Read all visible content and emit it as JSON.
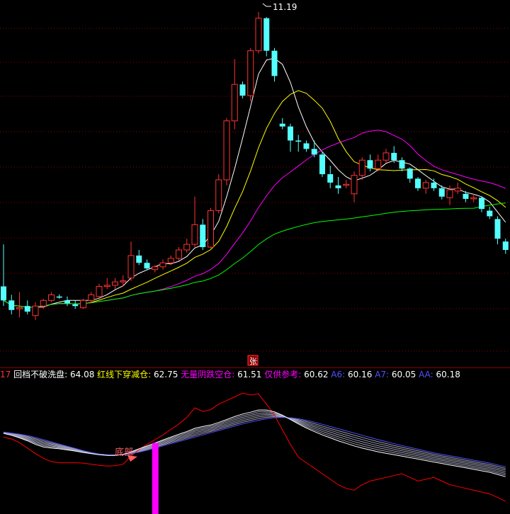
{
  "colors": {
    "background": "#000000",
    "grid": "#8b0000",
    "up": "#ff3232",
    "down": "#54ffff",
    "ma5": "#ffffff",
    "ma10": "#ffff00",
    "ma20": "#ff00ff",
    "ma60": "#00ff00",
    "red_line": "#ff0000",
    "blue_line": "#5050ff",
    "bar_magenta": "#ff00ff"
  },
  "top_chart": {
    "high_label": "11.19",
    "marker_label": "张"
  },
  "legend": {
    "left_num": "17",
    "items": [
      {
        "label": "回档不破洗盘:",
        "value": "64.08",
        "color": "#ffffff"
      },
      {
        "label": "红线下穿减仓:",
        "value": "62.75",
        "color": "#ffff00"
      },
      {
        "label": "无量阴跌空仓:",
        "value": "61.51",
        "color": "#ff00ff"
      },
      {
        "label": "仅供参考:",
        "value": "60.62",
        "color": "#ff00ff"
      },
      {
        "label": "A6:",
        "value": "60.16",
        "color": "#5050ff"
      },
      {
        "label": "A7:",
        "value": "60.05",
        "color": "#5050ff"
      },
      {
        "label": "AA:",
        "value": "60.18",
        "color": "#5050ff"
      }
    ]
  },
  "bottom_chart": {
    "annotation": "底部"
  },
  "chart_data": [
    {
      "type": "candlestick",
      "high_marker": "11.19",
      "ohlc": [
        [
          6.3,
          7.05,
          5.95,
          6.05
        ],
        [
          6.05,
          6.15,
          5.8,
          5.88
        ],
        [
          5.9,
          6.2,
          5.75,
          5.92
        ],
        [
          5.95,
          6.05,
          5.8,
          5.85
        ],
        [
          5.78,
          6.02,
          5.7,
          5.95
        ],
        [
          5.95,
          6.08,
          5.9,
          6.05
        ],
        [
          6.05,
          6.2,
          6.02,
          6.15
        ],
        [
          6.12,
          6.16,
          6.08,
          6.1
        ],
        [
          6.05,
          6.12,
          5.95,
          6.0
        ],
        [
          5.98,
          6.05,
          5.9,
          5.95
        ],
        [
          5.92,
          6.08,
          5.9,
          6.05
        ],
        [
          6.05,
          6.2,
          6.0,
          6.15
        ],
        [
          6.12,
          6.35,
          6.1,
          6.3
        ],
        [
          6.3,
          6.45,
          6.25,
          6.32
        ],
        [
          6.32,
          6.45,
          6.25,
          6.38
        ],
        [
          6.38,
          6.5,
          6.3,
          6.4
        ],
        [
          6.45,
          7.1,
          6.4,
          6.85
        ],
        [
          6.85,
          6.95,
          6.68,
          6.72
        ],
        [
          6.72,
          6.78,
          6.6,
          6.62
        ],
        [
          6.6,
          6.68,
          6.55,
          6.65
        ],
        [
          6.65,
          6.78,
          6.6,
          6.72
        ],
        [
          6.72,
          6.85,
          6.68,
          6.8
        ],
        [
          6.8,
          7.0,
          6.75,
          6.95
        ],
        [
          6.95,
          7.15,
          6.9,
          7.05
        ],
        [
          7.05,
          7.9,
          7.0,
          7.4
        ],
        [
          7.4,
          7.5,
          6.95,
          7.0
        ],
        [
          7.0,
          7.7,
          6.98,
          7.65
        ],
        [
          7.65,
          8.3,
          7.6,
          8.2
        ],
        [
          8.2,
          9.3,
          8.1,
          9.25
        ],
        [
          9.25,
          10.35,
          9.1,
          9.9
        ],
        [
          9.9,
          9.95,
          9.65,
          9.7
        ],
        [
          9.7,
          10.55,
          9.6,
          10.5
        ],
        [
          10.5,
          11.19,
          10.45,
          11.08
        ],
        [
          11.08,
          11.1,
          10.4,
          10.5
        ],
        [
          10.5,
          10.55,
          9.95,
          10.05
        ],
        [
          9.2,
          9.3,
          9.1,
          9.15
        ],
        [
          9.15,
          9.2,
          8.7,
          8.9
        ],
        [
          8.9,
          9.0,
          8.7,
          8.88
        ],
        [
          8.85,
          8.9,
          8.7,
          8.75
        ],
        [
          8.75,
          8.9,
          8.6,
          8.65
        ],
        [
          8.65,
          8.7,
          8.25,
          8.3
        ],
        [
          8.3,
          8.45,
          8.05,
          8.15
        ],
        [
          8.1,
          8.25,
          7.95,
          8.05
        ],
        [
          8.1,
          8.2,
          8.05,
          8.12
        ],
        [
          7.95,
          8.35,
          7.8,
          8.28
        ],
        [
          8.28,
          8.6,
          8.2,
          8.55
        ],
        [
          8.55,
          8.65,
          8.35,
          8.4
        ],
        [
          8.4,
          8.65,
          8.35,
          8.55
        ],
        [
          8.55,
          8.75,
          8.5,
          8.68
        ],
        [
          8.68,
          8.8,
          8.5,
          8.55
        ],
        [
          8.55,
          8.6,
          8.35,
          8.4
        ],
        [
          8.4,
          8.42,
          8.15,
          8.22
        ],
        [
          8.22,
          8.25,
          8.0,
          8.05
        ],
        [
          8.05,
          8.2,
          7.95,
          8.15
        ],
        [
          8.15,
          8.22,
          8.0,
          8.05
        ],
        [
          8.05,
          8.1,
          7.85,
          7.9
        ],
        [
          7.88,
          8.1,
          7.75,
          8.02
        ],
        [
          8.0,
          8.15,
          7.95,
          8.05
        ],
        [
          7.95,
          8.0,
          7.8,
          7.86
        ],
        [
          7.86,
          7.95,
          7.8,
          7.88
        ],
        [
          7.88,
          7.9,
          7.62,
          7.68
        ],
        [
          7.65,
          7.72,
          7.5,
          7.55
        ],
        [
          7.5,
          7.55,
          7.05,
          7.15
        ],
        [
          7.1,
          7.15,
          6.88,
          6.95
        ]
      ]
    },
    {
      "type": "line",
      "series": [
        {
          "name": "回档不破洗盘",
          "value": "64.08"
        },
        {
          "name": "红线下穿减仓",
          "value": "62.75"
        },
        {
          "name": "无量阴跌空仓",
          "value": "61.51"
        },
        {
          "name": "仅供参考",
          "value": "60.62"
        },
        {
          "name": "A6",
          "value": "60.16"
        },
        {
          "name": "A7",
          "value": "60.05"
        },
        {
          "name": "AA",
          "value": "60.18"
        }
      ],
      "red_line": [
        56.0,
        55.5,
        54.5,
        53.0,
        51.5,
        50.2,
        49.3,
        49.0,
        49.0,
        49.0,
        48.9,
        48.6,
        48.3,
        48.1,
        48.2,
        48.6,
        50.8,
        52.6,
        54.0,
        55.3,
        56.6,
        58.1,
        59.6,
        61.4,
        64.0,
        63.0,
        63.5,
        65.0,
        66.0,
        67.0,
        68.0,
        67.5,
        67.8,
        65.0,
        62.0,
        58.0,
        54.0,
        50.5,
        49.0,
        47.5,
        46.0,
        44.5,
        43.0,
        42.0,
        41.5,
        43.0,
        44.0,
        44.5,
        45.0,
        45.5,
        46.0,
        45.0,
        44.0,
        44.5,
        45.0,
        44.0,
        43.0,
        42.5,
        42.0,
        41.5,
        41.0,
        40.5,
        39.5,
        38.5
      ],
      "white_line": [
        57.0,
        56.5,
        55.8,
        55.0,
        54.0,
        53.3,
        53.0,
        52.8,
        52.5,
        52.2,
        51.8,
        51.5,
        51.2,
        51.0,
        51.0,
        51.3,
        52.0,
        52.8,
        53.6,
        54.4,
        55.2,
        56.0,
        56.8,
        57.5,
        58.4,
        58.9,
        59.3,
        60.0,
        60.8,
        61.6,
        62.3,
        62.8,
        63.4,
        63.4,
        62.9,
        62.0,
        60.8,
        59.6,
        58.5,
        57.5,
        56.6,
        55.8,
        55.0,
        54.3,
        53.6,
        53.0,
        52.5,
        52.0,
        51.6,
        51.2,
        50.8,
        50.4,
        50.0,
        49.6,
        49.2,
        48.8,
        48.4,
        48.0,
        47.6,
        47.2,
        46.8,
        46.4,
        45.8,
        45.2
      ],
      "blue_line": [
        57.4,
        57.1,
        56.8,
        56.4,
        55.9,
        55.3,
        54.7,
        54.1,
        53.5,
        52.9,
        52.3,
        51.8,
        51.4,
        51.2,
        51.1,
        51.2,
        51.5,
        51.9,
        52.4,
        53.0,
        53.6,
        54.2,
        54.8,
        55.4,
        56.0,
        56.6,
        57.2,
        57.8,
        58.4,
        59.0,
        59.6,
        60.1,
        60.6,
        61.0,
        61.3,
        61.4,
        61.3,
        61.0,
        60.6,
        60.1,
        59.5,
        58.9,
        58.3,
        57.7,
        57.1,
        56.5,
        55.9,
        55.3,
        54.8,
        54.2,
        53.7,
        53.2,
        52.7,
        52.2,
        51.7,
        51.3,
        50.9,
        50.5,
        50.1,
        49.7,
        49.3,
        48.9,
        48.4,
        47.9
      ],
      "bar_at": 19,
      "bar_value": 9
    }
  ]
}
